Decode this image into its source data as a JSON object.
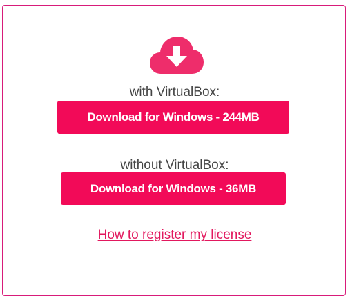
{
  "download_icon": "cloud-download-icon",
  "with_virtualbox": {
    "label": "with VirtualBox:",
    "button_label": "Download for Windows - 244MB"
  },
  "without_virtualbox": {
    "label": "without VirtualBox:",
    "button_label": "Download for Windows - 36MB"
  },
  "license_link": "How to register my license",
  "colors": {
    "accent": "#f20a58",
    "icon": "#ee2d6b",
    "border": "#d81b7a",
    "text": "#444444",
    "link": "#e2185e"
  }
}
